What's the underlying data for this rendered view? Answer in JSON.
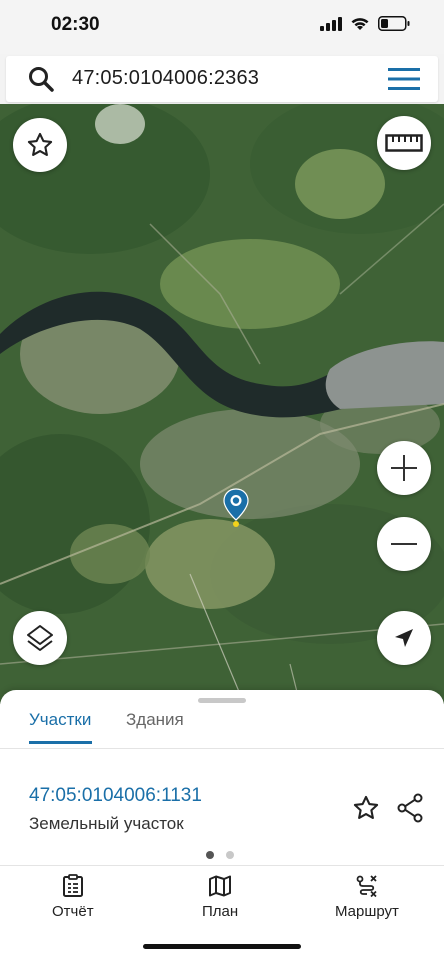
{
  "status_bar": {
    "time": "02:30"
  },
  "search": {
    "query": "47:05:0104006:2363",
    "search_icon": "search-icon",
    "menu_icon": "menu-icon"
  },
  "map": {
    "buttons": {
      "favorite_icon": "star-icon",
      "ruler_icon": "ruler-icon",
      "zoom_in_icon": "plus-icon",
      "zoom_out_icon": "minus-icon",
      "layers_icon": "layers-icon",
      "location_icon": "navigation-arrow-icon"
    },
    "marker_icon": "map-pin-icon"
  },
  "sheet": {
    "tabs": [
      {
        "label": "Участки",
        "active": true
      },
      {
        "label": "Здания",
        "active": false
      }
    ],
    "card": {
      "number": "47:05:0104006:1131",
      "type": "Земельный участок",
      "star_icon": "star-outline-icon",
      "share_icon": "share-icon"
    },
    "pager": {
      "total": 2,
      "active": 1
    }
  },
  "bottom_nav": {
    "items": [
      {
        "label": "Отчёт",
        "icon": "report-icon"
      },
      {
        "label": "План",
        "icon": "map-plan-icon"
      },
      {
        "label": "Маршрут",
        "icon": "route-icon"
      }
    ]
  },
  "colors": {
    "accent": "#1a6fa8",
    "map_forest": "#3d5e36",
    "river": "#1f2b2a"
  }
}
